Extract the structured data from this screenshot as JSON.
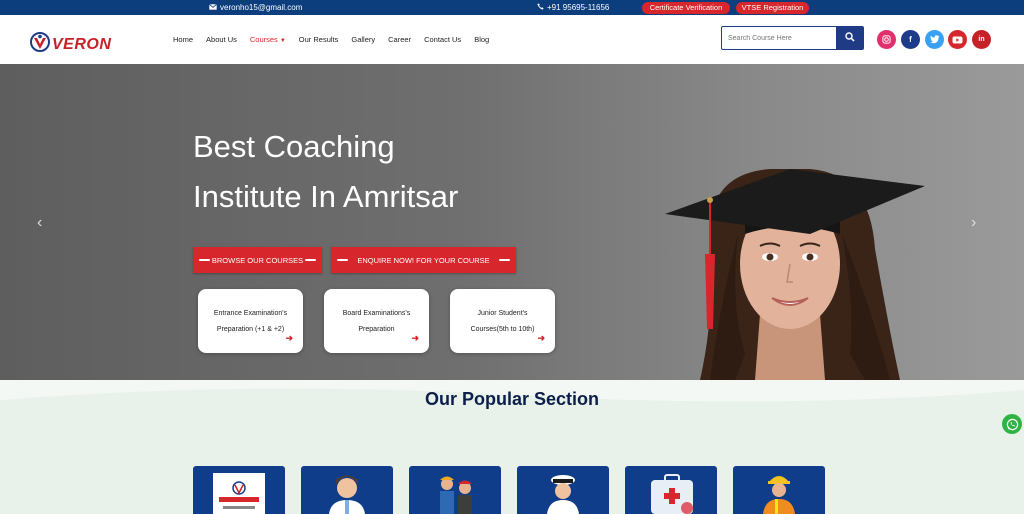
{
  "topbar": {
    "email": "veronho15@gmail.com",
    "phone": "+91 95695-11656",
    "cert_label": "Certificate Verification",
    "vtse_label": "VTSE Registration",
    "bg_color": "#0c3d7d",
    "accent_color": "#d7262c"
  },
  "header": {
    "logo_text": "VERON",
    "nav": [
      {
        "label": "Home"
      },
      {
        "label": "About Us"
      },
      {
        "label": "Courses",
        "active": true,
        "has_dropdown": true
      },
      {
        "label": "Our Results"
      },
      {
        "label": "Gallery"
      },
      {
        "label": "Career"
      },
      {
        "label": "Contact Us"
      },
      {
        "label": "Blog"
      }
    ],
    "search_placeholder": "Search Course Here",
    "social": [
      {
        "name": "instagram-icon",
        "color": "#e1306c",
        "glyph": "◎"
      },
      {
        "name": "facebook-icon",
        "color": "#1e3a8a",
        "glyph": "f"
      },
      {
        "name": "twitter-icon",
        "color": "#38a1f3",
        "glyph": "t"
      },
      {
        "name": "youtube-icon",
        "color": "#d7262c",
        "glyph": "▶"
      },
      {
        "name": "linkedin-icon",
        "color": "#c62127",
        "glyph": "in"
      }
    ]
  },
  "hero": {
    "title_line1": "Best Coaching",
    "title_line2": "Institute In Amritsar",
    "browse_label": "BROWSE OUR COURSES",
    "enquire_label": "ENQUIRE NOW! FOR YOUR COURSE",
    "cards": [
      {
        "line1": "Entrance Examination's",
        "line2": "Preparation (+1 & +2)"
      },
      {
        "line1": "Board Examinations's",
        "line2": "Preparation"
      },
      {
        "line1": "Junior Student's",
        "line2": "Courses(5th to 10th)"
      }
    ]
  },
  "popular": {
    "title": "Our Popular Section",
    "tiles": [
      {
        "name": "veron-brochure"
      },
      {
        "name": "doctor"
      },
      {
        "name": "engineers"
      },
      {
        "name": "navy-officer"
      },
      {
        "name": "medical-kit"
      },
      {
        "name": "construction-worker"
      }
    ]
  }
}
